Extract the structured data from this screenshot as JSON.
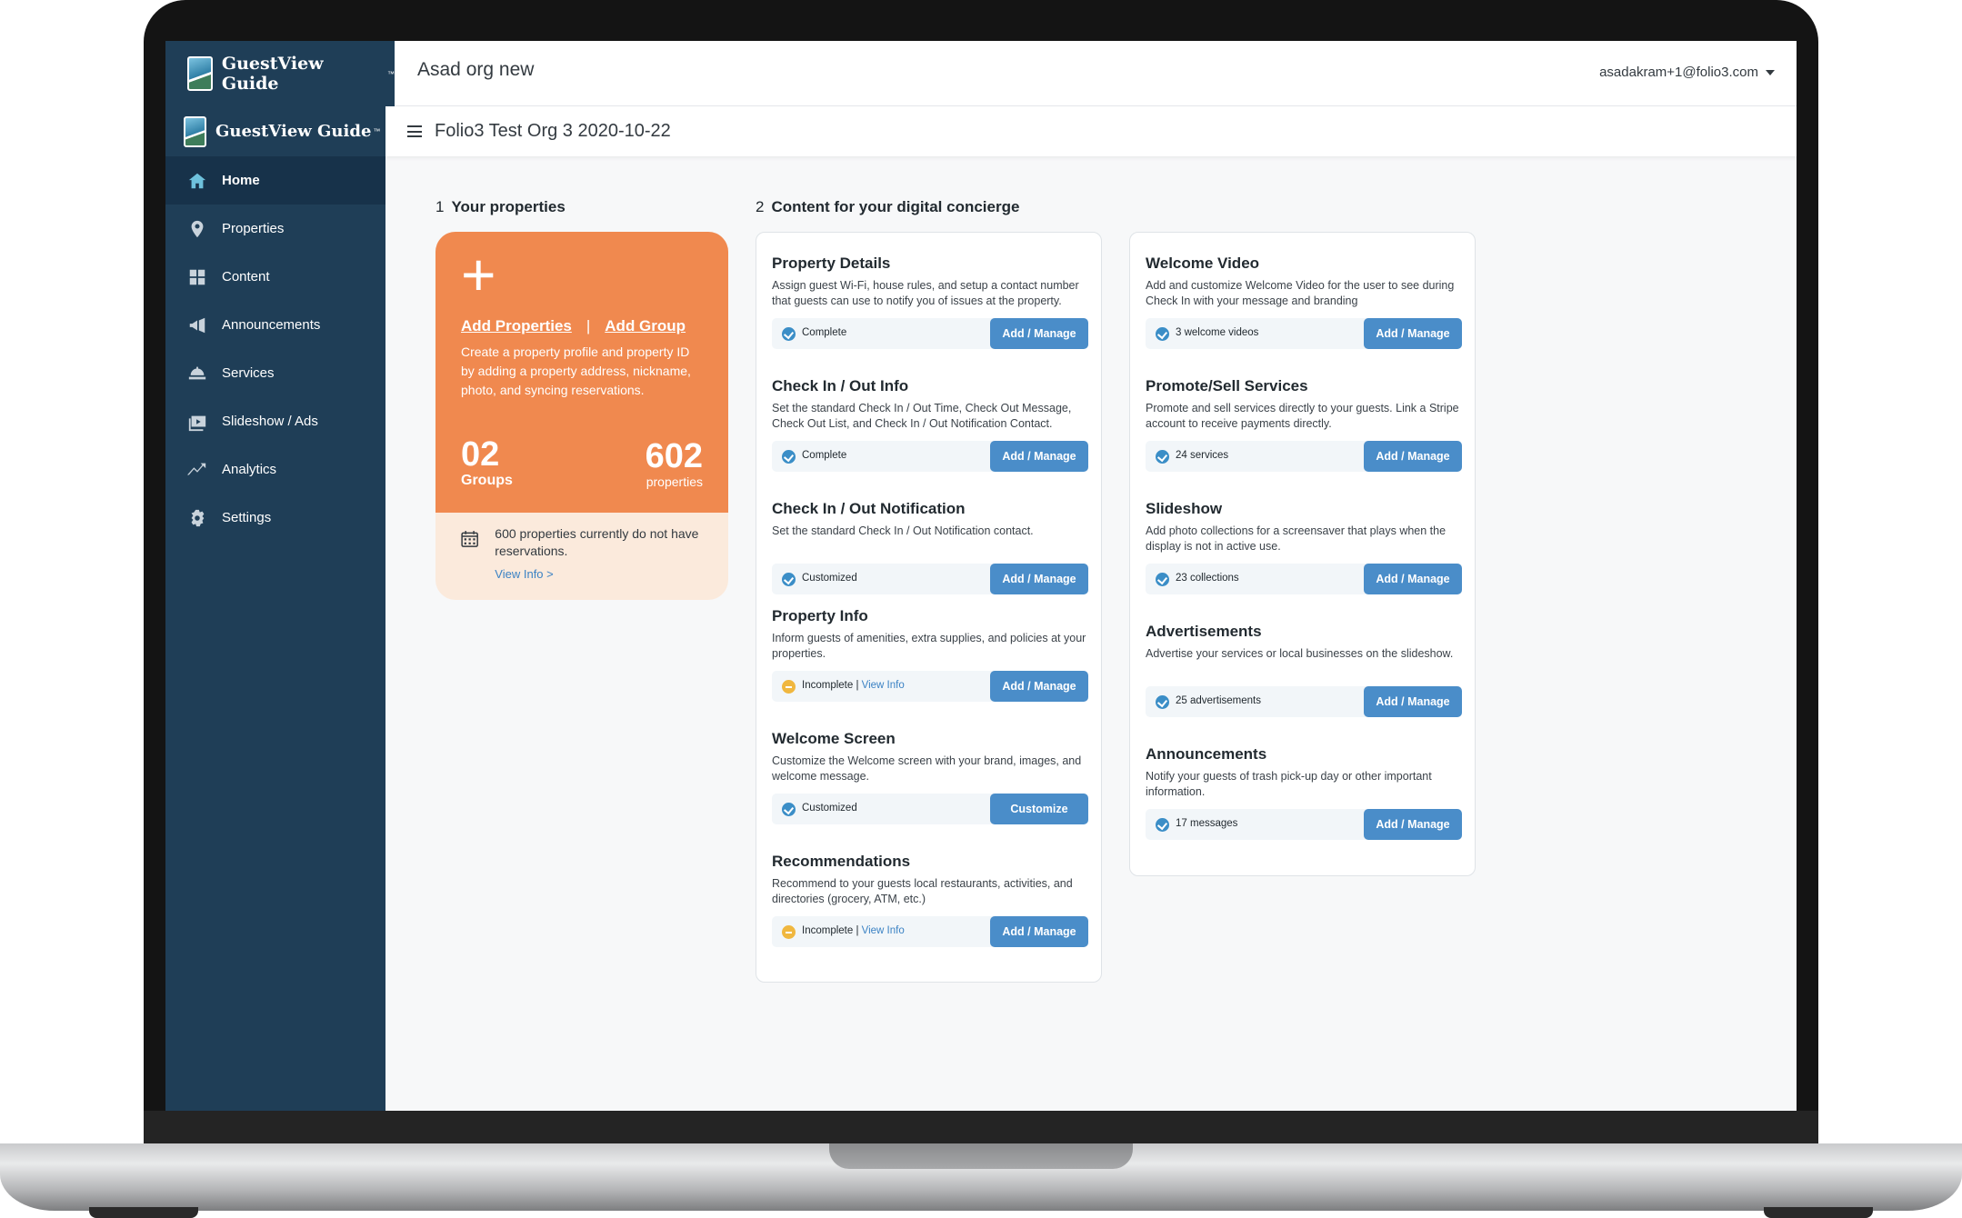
{
  "app": {
    "logo_text": "GuestView Guide",
    "logo_tm": "™",
    "org_name": "Asad org new",
    "user_email": "asadakram+1@folio3.com",
    "sub_org": "Folio3 Test Org 3 2020-10-22"
  },
  "sidebar": {
    "items": [
      {
        "label": "Home",
        "icon": "home-icon"
      },
      {
        "label": "Properties",
        "icon": "map-pin-icon"
      },
      {
        "label": "Content",
        "icon": "grid-icon"
      },
      {
        "label": "Announcements",
        "icon": "megaphone-icon"
      },
      {
        "label": "Services",
        "icon": "service-bell-icon"
      },
      {
        "label": "Slideshow / Ads",
        "icon": "slideshow-icon"
      },
      {
        "label": "Analytics",
        "icon": "chart-line-icon"
      },
      {
        "label": "Settings",
        "icon": "gear-icon"
      }
    ]
  },
  "section1": {
    "num": "1",
    "title": "Your properties"
  },
  "section2": {
    "num": "2",
    "title": "Content for your digital concierge"
  },
  "properties_card": {
    "plus": "+",
    "add_properties": "Add Properties",
    "separator": "|",
    "add_group": "Add Group",
    "description": "Create a property profile and property ID by adding a property address, nickname, photo, and syncing reservations.",
    "groups_count": "02",
    "groups_label": "Groups",
    "properties_count": "602",
    "properties_label": "properties",
    "reservations_note": "600 properties currently do not have reservations.",
    "view_info": "View Info >"
  },
  "content_left": [
    {
      "title": "Property Details",
      "desc": "Assign guest Wi-Fi, house rules, and setup a contact number that guests can use to notify you of issues at the property.",
      "status": "Complete",
      "link": "",
      "state": "ok",
      "button": "Add / Manage"
    },
    {
      "title": "Check In / Out Info",
      "desc": "Set the standard Check In / Out Time, Check Out Message, Check Out List, and Check In / Out Notification Contact.",
      "status": "Complete",
      "link": "",
      "state": "ok",
      "button": "Add / Manage"
    },
    {
      "title": "Check In / Out Notification",
      "desc": "Set the standard Check In / Out Notification contact.",
      "status": "Customized",
      "link": "",
      "state": "ok",
      "button": "Add / Manage"
    },
    {
      "title": "Property Info",
      "desc": "Inform guests of amenities, extra supplies, and policies at your properties.",
      "status": "Incomplete | ",
      "link": "View Info",
      "state": "warn",
      "button": "Add / Manage"
    },
    {
      "title": "Welcome Screen",
      "desc": "Customize the Welcome screen with your brand, images, and welcome message.",
      "status": "Customized",
      "link": "",
      "state": "ok",
      "button": "Customize"
    },
    {
      "title": "Recommendations",
      "desc": "Recommend to your guests local restaurants, activities, and directories (grocery, ATM, etc.)",
      "status": "Incomplete | ",
      "link": "View Info",
      "state": "warn",
      "button": "Add / Manage"
    }
  ],
  "content_right": [
    {
      "title": "Welcome Video",
      "desc": "Add and customize Welcome Video for the user to see during Check In with your message and branding",
      "status": "3 welcome videos",
      "link": "",
      "state": "ok",
      "button": "Add / Manage"
    },
    {
      "title": "Promote/Sell Services",
      "desc": "Promote and sell services directly to your guests. Link a Stripe account to receive payments directly.",
      "status": "24 services",
      "link": "",
      "state": "ok",
      "button": "Add / Manage"
    },
    {
      "title": "Slideshow",
      "desc": "Add photo collections for a screensaver that plays when the display is not in active use.",
      "status": "23 collections",
      "link": "",
      "state": "ok",
      "button": "Add / Manage"
    },
    {
      "title": "Advertisements",
      "desc": "Advertise your services or local businesses on the slideshow.",
      "status": "25 advertisements",
      "link": "",
      "state": "ok",
      "button": "Add / Manage"
    },
    {
      "title": "Announcements",
      "desc": "Notify your guests of trash pick-up day or other important information.",
      "status": "17 messages",
      "link": "",
      "state": "ok",
      "button": "Add / Manage"
    }
  ]
}
